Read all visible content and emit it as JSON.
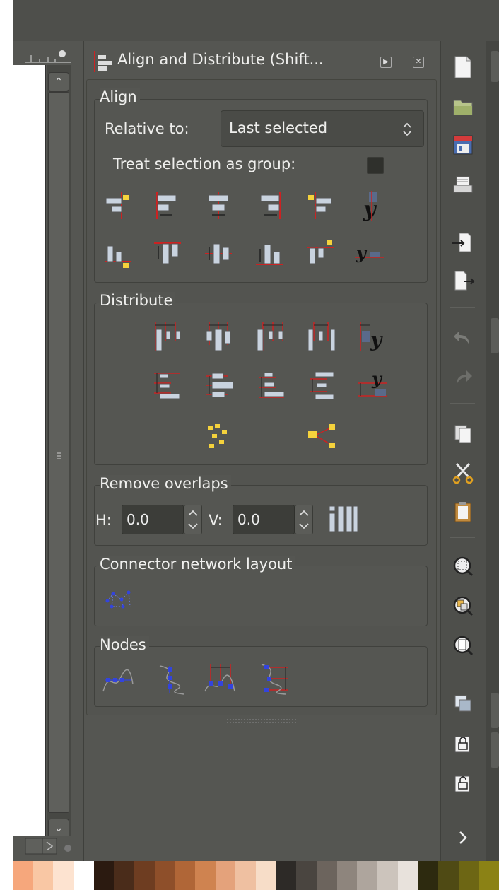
{
  "panel": {
    "title": "Align and Distribute (Shift..."
  },
  "align": {
    "frame_title": "Align",
    "relative_to_label": "Relative to:",
    "relative_to_value": "Last selected",
    "treat_group_label": "Treat selection as group:",
    "treat_group_checked": false
  },
  "distribute": {
    "frame_title": "Distribute"
  },
  "remove_overlaps": {
    "frame_title": "Remove overlaps",
    "h_label": "H:",
    "h_value": "0.0",
    "v_label": "V:",
    "v_value": "0.0"
  },
  "connector": {
    "frame_title": "Connector network layout"
  },
  "nodes": {
    "frame_title": "Nodes"
  },
  "toolbar_icons": [
    "new-document-icon",
    "open-folder-icon",
    "save-icon",
    "print-icon",
    "import-icon",
    "export-icon",
    "undo-icon",
    "redo-icon",
    "copy-icon",
    "cut-icon",
    "paste-icon",
    "zoom-selection-icon",
    "zoom-drawing-icon",
    "zoom-page-icon",
    "duplicate-icon",
    "clone-icon",
    "unlink-clone-icon",
    "more-chevron-icon"
  ],
  "colors": {
    "panel_bg": "#555652",
    "selection_red": "#cc2222",
    "object_fill": "#c9d3df",
    "anchor_yellow": "#f5d23c",
    "node_blue": "#3344dd"
  },
  "palette": [
    "#f6a77c",
    "#f9c7a4",
    "#fde3d0",
    "#ffffff",
    "#2b1a10",
    "#4a2c1a",
    "#6e3d21",
    "#8e4f2a",
    "#b06637",
    "#cf8350",
    "#e4a27b",
    "#efc0a1",
    "#f7ddc8",
    "#2d2a27",
    "#4a4540",
    "#6c645d",
    "#8e857d",
    "#aea59d",
    "#ccc4bc",
    "#e8e2dc",
    "#2d2a0f",
    "#4f4a14",
    "#6d6614",
    "#8b8215"
  ]
}
